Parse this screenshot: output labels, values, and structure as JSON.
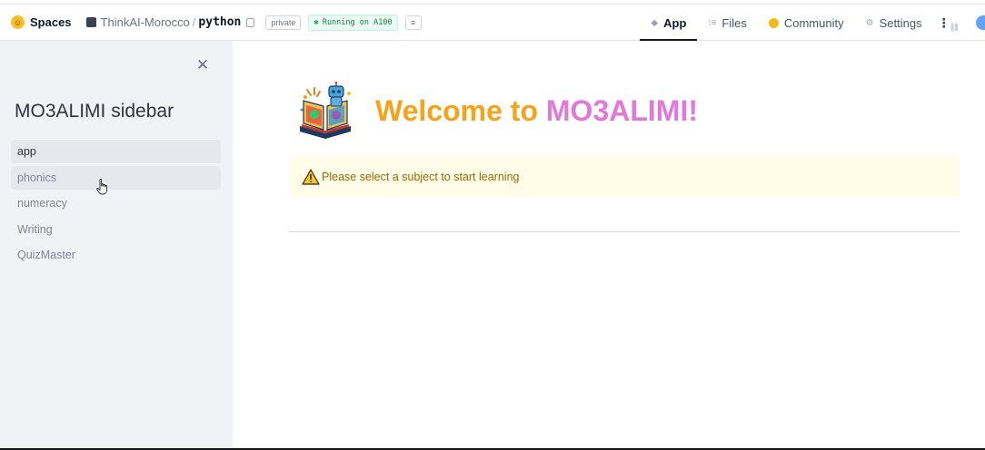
{
  "header": {
    "spaces_label": "Spaces",
    "org_name": "ThinkAI-Morocco",
    "separator": "/",
    "repo_name": "python",
    "visibility_badge": "private",
    "status_badge": "Running on A100",
    "tabs": [
      {
        "label": "App",
        "icon": "app-cube-icon",
        "active": true
      },
      {
        "label": "Files",
        "icon": "files-icon",
        "active": false
      },
      {
        "label": "Community",
        "icon": "community-icon",
        "active": false
      },
      {
        "label": "Settings",
        "icon": "gear-icon",
        "active": false
      }
    ]
  },
  "sidebar": {
    "title": "MO3ALIMI sidebar",
    "items": [
      {
        "label": "app",
        "selected": true
      },
      {
        "label": "phonics",
        "selected": false
      },
      {
        "label": "numeracy",
        "selected": false
      },
      {
        "label": "Writing",
        "selected": false
      },
      {
        "label": "QuizMaster",
        "selected": false
      }
    ]
  },
  "main": {
    "welcome_prefix": "Welcome to ",
    "welcome_brand": "MO3ALIMI!",
    "alert_text": "Please select a subject to start learning"
  },
  "colors": {
    "accent_orange": "#f4a31a",
    "accent_pink": "#e07ad8",
    "sidebar_bg": "#f0f2f6",
    "alert_bg": "#fffce7",
    "alert_text": "#926c05",
    "running_green": "#15803d"
  }
}
